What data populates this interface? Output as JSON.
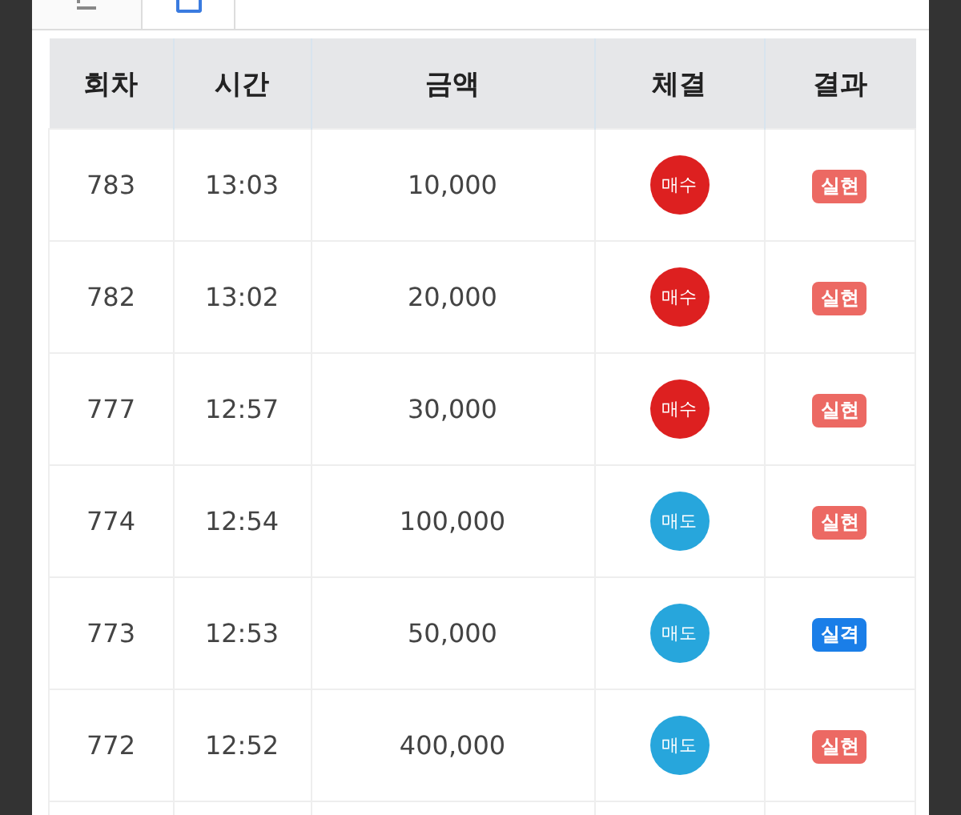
{
  "tabs": [
    {
      "selected": false
    },
    {
      "selected": true
    }
  ],
  "table": {
    "columns": [
      "회차",
      "시간",
      "금액",
      "체결",
      "결과"
    ],
    "rows": [
      {
        "round": "783",
        "time": "13:03",
        "amount": "10,000",
        "trade": {
          "kind": "buy",
          "label": "매수"
        },
        "result": {
          "kind": "hit",
          "label": "실현"
        }
      },
      {
        "round": "782",
        "time": "13:02",
        "amount": "20,000",
        "trade": {
          "kind": "buy",
          "label": "매수"
        },
        "result": {
          "kind": "hit",
          "label": "실현"
        }
      },
      {
        "round": "777",
        "time": "12:57",
        "amount": "30,000",
        "trade": {
          "kind": "buy",
          "label": "매수"
        },
        "result": {
          "kind": "hit",
          "label": "실현"
        }
      },
      {
        "round": "774",
        "time": "12:54",
        "amount": "100,000",
        "trade": {
          "kind": "sell",
          "label": "매도"
        },
        "result": {
          "kind": "hit",
          "label": "실현"
        }
      },
      {
        "round": "773",
        "time": "12:53",
        "amount": "50,000",
        "trade": {
          "kind": "sell",
          "label": "매도"
        },
        "result": {
          "kind": "miss",
          "label": "실격"
        }
      },
      {
        "round": "772",
        "time": "12:52",
        "amount": "400,000",
        "trade": {
          "kind": "sell",
          "label": "매도"
        },
        "result": {
          "kind": "hit",
          "label": "실현"
        }
      }
    ]
  }
}
